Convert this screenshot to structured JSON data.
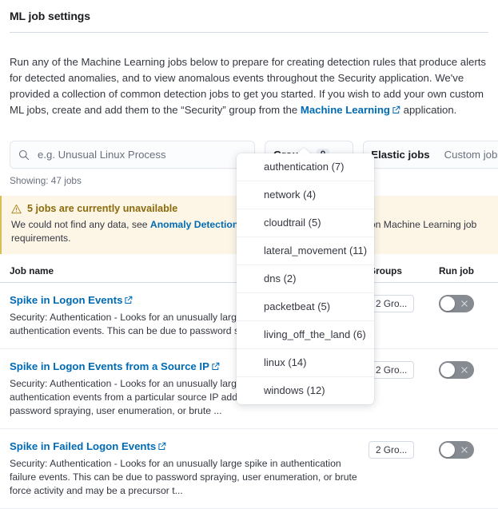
{
  "page": {
    "title": "ML job settings",
    "intro_parts": {
      "before_link": "Run any of the Machine Learning jobs below to prepare for creating detection rules that produce alerts for detected anomalies, and to view anomalous events throughout the Security application. We've provided a collection of common detection jobs to get you started. If you wish to add your own custom ML jobs, create and add them to the “Security” group from the ",
      "link_text": "Machine Learning",
      "after_link": " application."
    }
  },
  "search": {
    "placeholder": "e.g. Unusual Linux Process",
    "value": "",
    "icon": "search-icon"
  },
  "groups_button": {
    "label": "Groups",
    "count": "9",
    "icon": "chevron-down-icon"
  },
  "tabs": [
    {
      "label": "Elastic jobs",
      "selected": true
    },
    {
      "label": "Custom jobs",
      "selected": false
    }
  ],
  "showing": "Showing: 47 jobs",
  "callout": {
    "icon": "warning-triangle-icon",
    "title": "5 jobs are currently unavailable",
    "body_before_link": "We could not find any data, see ",
    "body_link": "Anomaly Detection with ML",
    "body_after_link": " for more information on Machine Learning job requirements.",
    "background": "#fdf6e7",
    "accent": "#8a6a0a"
  },
  "groups_dropdown": {
    "open": true,
    "items": [
      "authentication (7)",
      "network (4)",
      "cloudtrail (5)",
      "lateral_movement (11)",
      "dns (2)",
      "packetbeat (5)",
      "living_off_the_land (6)",
      "linux (14)",
      "windows (12)"
    ]
  },
  "table": {
    "headers": {
      "job_name": "Job name",
      "groups": "Groups",
      "run_job": "Run job"
    },
    "rows": [
      {
        "name": "Spike in Logon Events",
        "description": "Security: Authentication - Looks for an unusually large spike in successful authentication events. This can be due to password spraying, user enu...",
        "groups_badge": "2 Gro...",
        "run_enabled": false
      },
      {
        "name": "Spike in Logon Events from a Source IP",
        "description": "Security: Authentication - Looks for an unusually large spike in successful authentication events from a particular source IP address. This can be due to password spraying, user enumeration, or brute ...",
        "groups_badge": "2 Gro...",
        "run_enabled": false
      },
      {
        "name": "Spike in Failed Logon Events",
        "description": "Security: Authentication - Looks for an unusually large spike in authentication failure events. This can be due to password spraying, user enumeration, or brute force activity and may be a precursor t...",
        "groups_badge": "2 Gro...",
        "run_enabled": false
      }
    ]
  },
  "colors": {
    "link": "#006bb4",
    "text": "#343741",
    "heading": "#1a1c21",
    "border": "#d3dae6",
    "toggle_off": "#868a91"
  }
}
